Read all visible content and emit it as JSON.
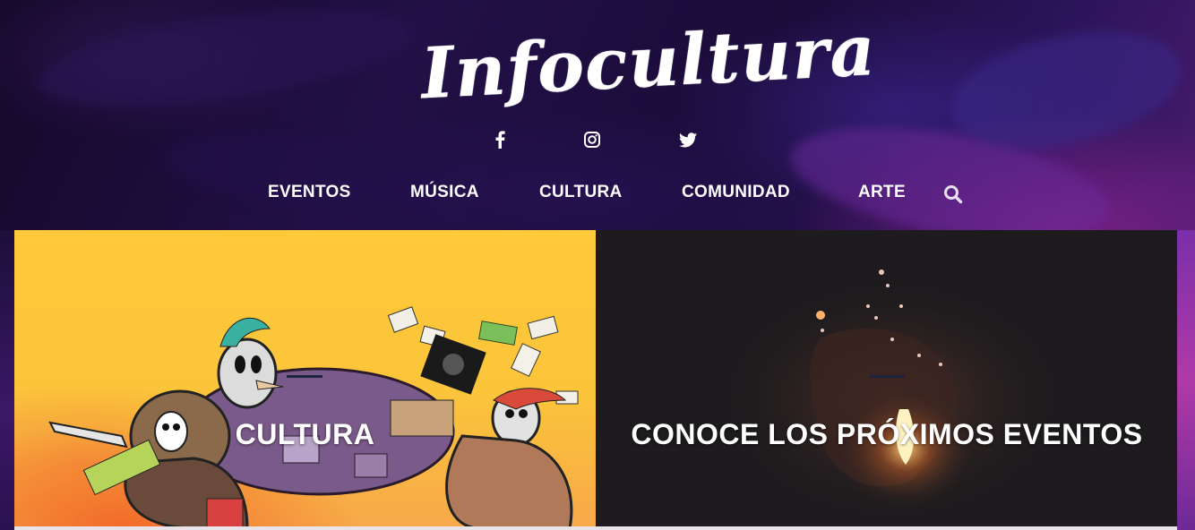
{
  "site": {
    "logo_text": "Infocultura"
  },
  "social": [
    {
      "name": "facebook-icon"
    },
    {
      "name": "instagram-icon"
    },
    {
      "name": "twitter-icon"
    }
  ],
  "nav": {
    "items": [
      {
        "label": "EVENTOS"
      },
      {
        "label": "MÚSICA"
      },
      {
        "label": "CULTURA"
      },
      {
        "label": "COMUNIDAD"
      },
      {
        "label": "ARTE"
      }
    ],
    "search_icon": "search-icon"
  },
  "tiles": [
    {
      "title": "CULTURA"
    },
    {
      "title": "CONOCE LOS PRÓXIMOS EVENTOS"
    }
  ],
  "colors": {
    "header_bg": "#1b0c3a",
    "accent_purple": "#5a1f7a",
    "tile_left_bg": "#fbc43a",
    "tile_right_bg": "#1d1b1e",
    "text": "#ffffff"
  }
}
